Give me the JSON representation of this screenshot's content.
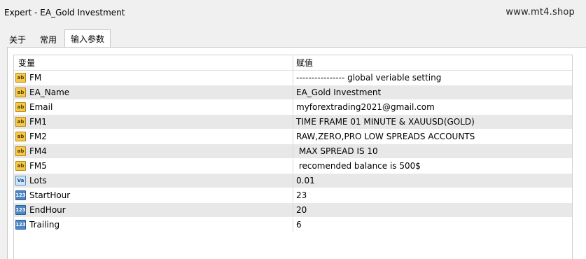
{
  "window": {
    "title": "Expert - EA_Gold Investment",
    "watermark": "www.mt4.shop"
  },
  "tabs": [
    {
      "label": "关于",
      "active": false
    },
    {
      "label": "常用",
      "active": false
    },
    {
      "label": "输入参数",
      "active": true
    }
  ],
  "table": {
    "headers": {
      "variable": "变量",
      "value": "赋值"
    },
    "rows": [
      {
        "icon": "ab-string-icon",
        "name": "FM",
        "value": "---------------- global veriable setting"
      },
      {
        "icon": "ab-string-icon",
        "name": "EA_Name",
        "value": "EA_Gold Investment"
      },
      {
        "icon": "ab-string-icon",
        "name": "Email",
        "value": "myforextrading2021@gmail.com"
      },
      {
        "icon": "ab-string-icon",
        "name": "FM1",
        "value": "TIME FRAME 01 MINUTE & XAUUSD(GOLD)"
      },
      {
        "icon": "ab-string-icon",
        "name": "FM2",
        "value": "RAW,ZERO,PRO LOW SPREADS ACCOUNTS"
      },
      {
        "icon": "ab-string-icon",
        "name": "FM4",
        "value": " MAX SPREAD IS 10"
      },
      {
        "icon": "ab-string-icon",
        "name": "FM5",
        "value": " recomended balance is 500$"
      },
      {
        "icon": "double-value-icon",
        "name": "Lots",
        "value": "0.01"
      },
      {
        "icon": "integer-123-icon",
        "name": "StartHour",
        "value": "23"
      },
      {
        "icon": "integer-123-icon",
        "name": "EndHour",
        "value": "20"
      },
      {
        "icon": "integer-123-icon",
        "name": "Trailing",
        "value": "6"
      }
    ]
  },
  "icon_glyphs": {
    "ab-string-icon": "ab",
    "double-value-icon": "Va",
    "integer-123-icon": "123"
  }
}
